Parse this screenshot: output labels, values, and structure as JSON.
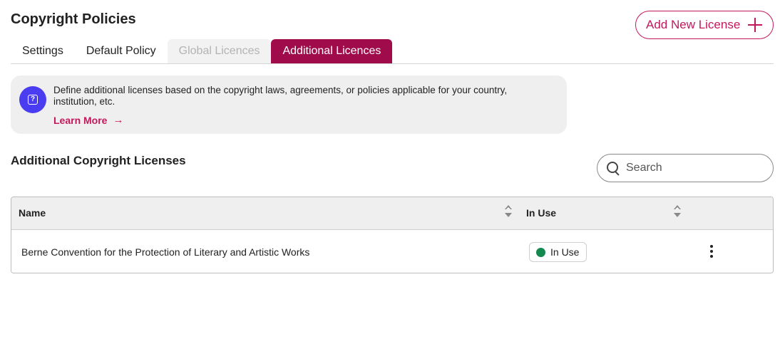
{
  "header": {
    "title": "Copyright Policies",
    "add_button_label": "Add New License"
  },
  "tabs": [
    {
      "label": "Settings",
      "state": "default"
    },
    {
      "label": "Default Policy",
      "state": "default"
    },
    {
      "label": "Global Licences",
      "state": "disabled"
    },
    {
      "label": "Additional Licences",
      "state": "active"
    }
  ],
  "info": {
    "text": "Define additional licenses based on the copyright laws, agreements, or policies applicable for your country, institution, etc.",
    "learn_more": "Learn More",
    "icon": "question-square-icon"
  },
  "section": {
    "title": "Additional Copyright Licenses"
  },
  "search": {
    "placeholder": "Search",
    "value": ""
  },
  "table": {
    "columns": [
      "Name",
      "In Use"
    ],
    "rows": [
      {
        "name": "Berne Convention for the Protection of Literary and Artistic Works",
        "status": "In Use"
      }
    ]
  },
  "colors": {
    "accent": "#c2185b",
    "active_tab": "#a00b4c",
    "info_icon": "#4a3cf0",
    "status_in_use": "#13894f"
  }
}
